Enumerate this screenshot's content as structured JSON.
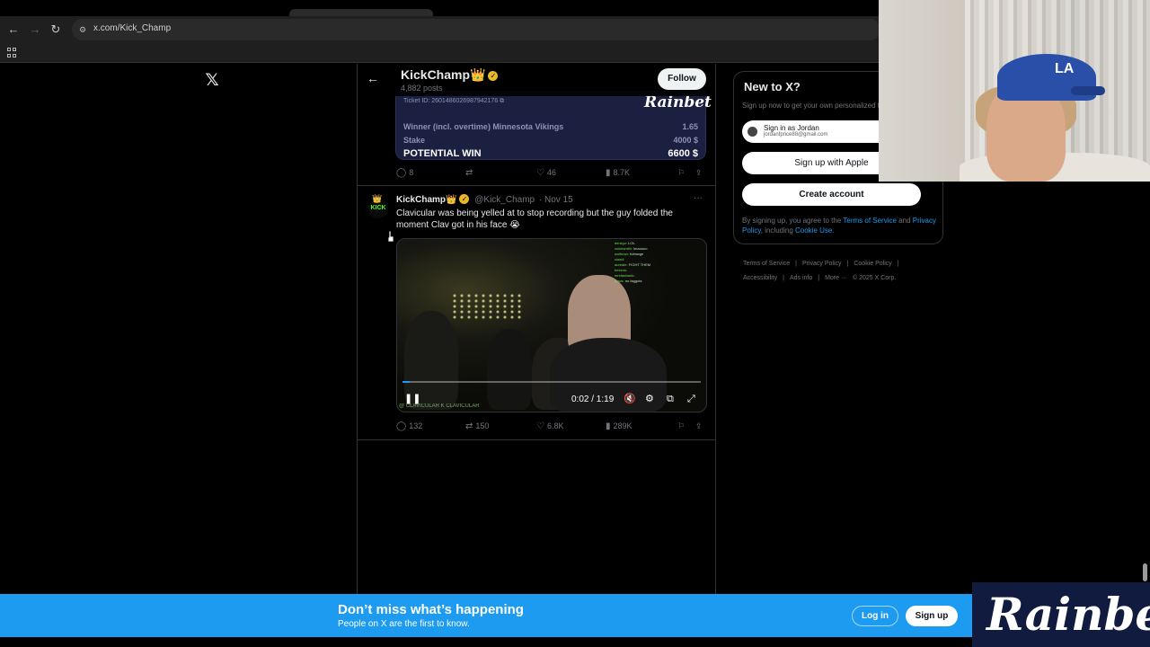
{
  "browser": {
    "url": "x.com/Kick_Champ"
  },
  "profile": {
    "name": "KickChamp",
    "crown": "👑",
    "posts": "4,882 posts",
    "follow_label": "Follow"
  },
  "bet_card": {
    "ticket_id": "Ticket ID: 2601486026987942176",
    "brand": "Rainbet",
    "selection": "Winner (incl. overtime) Minnesota Vikings",
    "odds": "1.65",
    "stake_label": "Stake",
    "stake": "4000 $",
    "potential_label": "POTENTIAL WIN",
    "potential": "6600 $"
  },
  "tweet1_actions": {
    "replies": "8",
    "reposts": "",
    "likes": "46",
    "views": "8.7K"
  },
  "tweet2": {
    "name": "KickChamp",
    "crown": "👑",
    "handle": "@Kick_Champ",
    "date": "· Nov 15",
    "text": "Clavicular was being yelled at to stop recording but the guy folded the moment Clav got in his face 😭",
    "avatar_text": "KICK",
    "video": {
      "time": "0:02 / 1:19",
      "progress": 0.025,
      "watermark": "@ CLAVICULAR  K CLAVICULAR",
      "chat": [
        [
          "deneyz:",
          "LOL"
        ],
        [
          "zukiesmith:",
          "lmaoooo"
        ],
        [
          "wolfman:",
          "fufmwge"
        ],
        [
          "claw4:",
          ""
        ],
        [
          "aureate:",
          "FIGHT THEM"
        ],
        [
          "beezus:",
          ""
        ],
        [
          "mrsfantastic:",
          ""
        ],
        [
          "jlwws:",
          "no faggots"
        ]
      ]
    },
    "actions": {
      "replies": "132",
      "reposts": "150",
      "likes": "6.8K",
      "views": "289K"
    }
  },
  "sidebar": {
    "title": "New to X?",
    "subtitle": "Sign up now to get your own personalized timeline!",
    "google_line1": "Sign in as Jordan",
    "google_line2": "jordanfprice88@gmail.com",
    "apple_label": "Sign up with Apple",
    "create_label": "Create account",
    "legal_prefix": "By signing up, you agree to the ",
    "terms": "Terms of Service",
    "legal_and": " and ",
    "privacy": "Privacy Policy",
    "legal_including": ", including ",
    "cookie": "Cookie Use",
    "legal_end": "."
  },
  "footer_links": {
    "terms": "Terms of Service",
    "privacy": "Privacy Policy",
    "cookie": "Cookie Policy",
    "accessibility": "Accessibility",
    "ads": "Ads info",
    "more": "More ···",
    "copyright": "© 2025 X Corp."
  },
  "banner": {
    "title": "Don’t miss what’s happening",
    "subtitle": "People on X are the first to know.",
    "login_label": "Log in",
    "signup_label": "Sign up"
  },
  "overlay": {
    "brand": "Rainbet"
  },
  "colors": {
    "accent": "#1d9bf0",
    "background": "#000000",
    "kick_green": "#53fc18"
  }
}
